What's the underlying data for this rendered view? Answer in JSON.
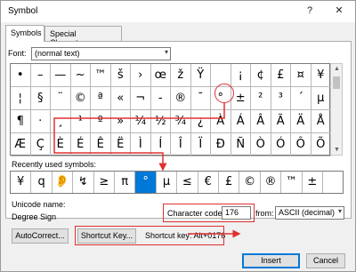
{
  "window": {
    "title": "Symbol",
    "help_glyph": "?",
    "close_glyph": "✕"
  },
  "tabs": [
    {
      "label": "Symbols"
    },
    {
      "label": "Special Characters"
    }
  ],
  "font": {
    "label": "Font:",
    "value": "(normal text)"
  },
  "symbol_grid": {
    "rows": [
      [
        "•",
        "–",
        "—",
        "~",
        "™",
        "š",
        "›",
        "œ",
        "ž",
        "Ÿ",
        " ",
        "¡",
        "¢",
        "£",
        "¤",
        "¥"
      ],
      [
        "¦",
        "§",
        "¨",
        "©",
        "ª",
        "«",
        "¬",
        "-",
        "®",
        "¯",
        "°",
        "±",
        "²",
        "³",
        "´",
        "µ"
      ],
      [
        "¶",
        "·",
        "¸",
        "¹",
        "º",
        "»",
        "¼",
        "½",
        "¾",
        "¿",
        "À",
        "Á",
        "Â",
        "Ã",
        "Ä",
        "Å"
      ],
      [
        "Æ",
        "Ç",
        "È",
        "É",
        "Ê",
        "Ë",
        "Ì",
        "Í",
        "Î",
        "Ï",
        "Ð",
        "Ñ",
        "Ò",
        "Ó",
        "Ô",
        "Õ"
      ]
    ]
  },
  "scrollbar": {
    "up_glyph": "▲",
    "down_glyph": "▼"
  },
  "recently_used": {
    "label": "Recently used symbols:",
    "symbols": [
      "¥",
      "q",
      "👂",
      "↯",
      "≥",
      "π",
      "°",
      "µ",
      "≤",
      "€",
      "£",
      "©",
      "®",
      "™",
      "±"
    ],
    "selected_index": 6
  },
  "unicode": {
    "name_label": "Unicode name:",
    "name_value": "Degree Sign"
  },
  "character_code": {
    "label": "Character code:",
    "value": "176"
  },
  "from": {
    "label": "from:",
    "value": "ASCII (decimal)"
  },
  "buttons": {
    "autocorrect": "AutoCorrect...",
    "shortcut_key": "Shortcut Key...",
    "insert": "Insert",
    "cancel": "Cancel"
  },
  "shortcut_text": "Shortcut key: Alt+0176",
  "dropdown_arrow": "▾",
  "colors": {
    "selected": "#0078d7",
    "annotation": "#e03030"
  }
}
